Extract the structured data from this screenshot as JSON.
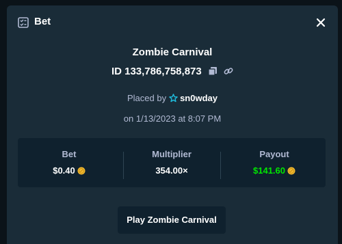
{
  "modal": {
    "title": "Bet",
    "icon": "bet-slip-icon",
    "close_icon": "close-icon"
  },
  "game": {
    "name": "Zombie Carnival",
    "bet_id": "ID 133,786,758,873"
  },
  "placed": {
    "prefix": "Placed by",
    "username": "sn0wday",
    "user_badge_icon": "star-icon",
    "date": "on 1/13/2023 at 8:07 PM"
  },
  "stats": {
    "bet": {
      "label": "Bet",
      "value": "$0.40",
      "currency_icon": "coin-icon"
    },
    "multiplier": {
      "label": "Multiplier",
      "value": "354.00×"
    },
    "payout": {
      "label": "Payout",
      "value": "$141.60",
      "currency_icon": "coin-icon"
    }
  },
  "actions": {
    "play_label": "Play Zombie Carnival"
  },
  "colors": {
    "modal_bg": "#1a2c38",
    "panel_bg": "#0f212e",
    "muted_text": "#b1bad3",
    "payout_green": "#00e701",
    "badge_blue": "#1fbfe0",
    "coin_gold": "#f3ba2f"
  }
}
